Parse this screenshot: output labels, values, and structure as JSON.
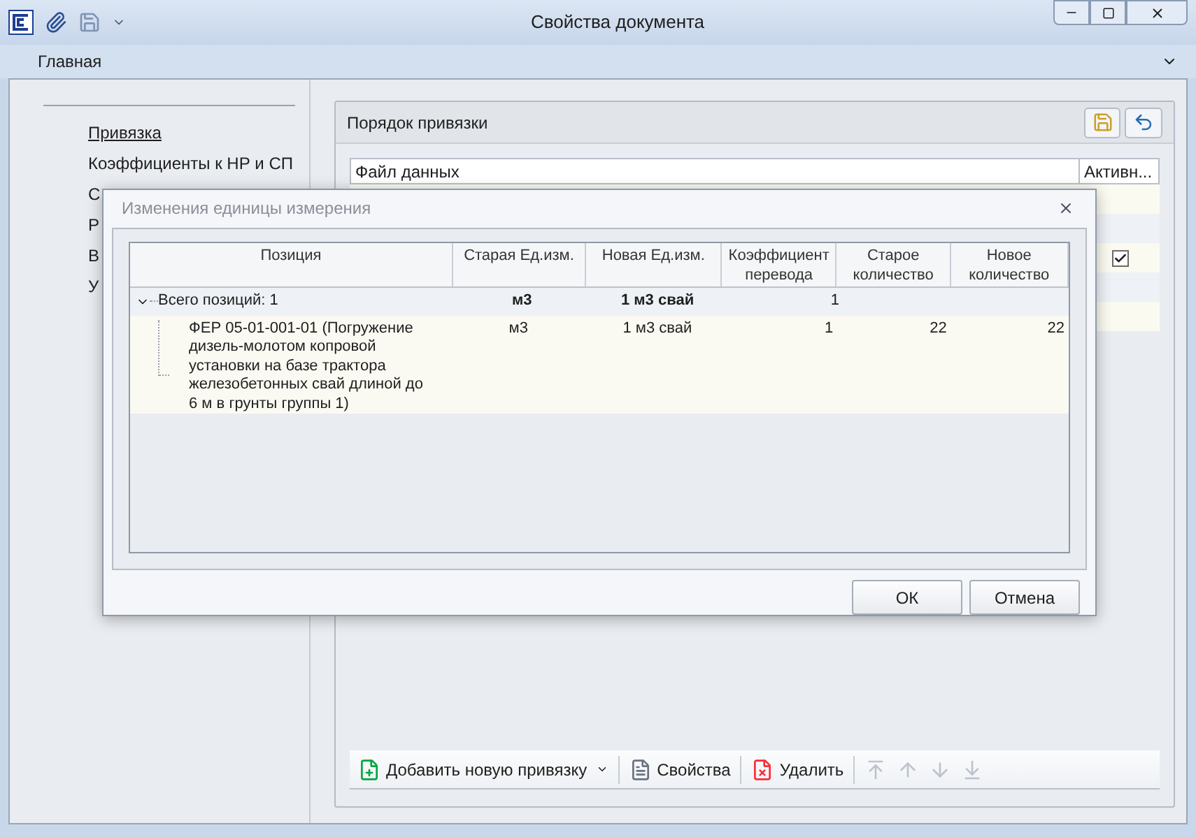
{
  "window": {
    "title": "Свойства документа"
  },
  "ribbon": {
    "tabs": [
      {
        "label": "Главная",
        "selected": true
      }
    ]
  },
  "sidebar": {
    "items": [
      {
        "label": "Привязка",
        "selected": true
      },
      {
        "label": "Коэффициенты к НР и СП",
        "selected": false
      },
      {
        "label": "С",
        "selected": false
      },
      {
        "label": "Р",
        "selected": false
      },
      {
        "label": "В",
        "selected": false
      },
      {
        "label": "У",
        "selected": false
      }
    ]
  },
  "binding_panel": {
    "title": "Порядок привязки",
    "columns": [
      "Файл данных",
      "Активн..."
    ],
    "rows": [
      {
        "active": false
      },
      {
        "active": false
      },
      {
        "active": true
      },
      {
        "active": false
      },
      {
        "active": false
      }
    ],
    "toolbar": [
      {
        "kind": "add",
        "label": "Добавить новую привязку",
        "disabled": false
      },
      {
        "kind": "props",
        "label": "Свойства",
        "disabled": false
      },
      {
        "kind": "delete",
        "label": "Удалить",
        "disabled": false
      },
      {
        "kind": "top",
        "disabled": true
      },
      {
        "kind": "up",
        "disabled": true
      },
      {
        "kind": "down",
        "disabled": true
      },
      {
        "kind": "bottom",
        "disabled": true
      }
    ]
  },
  "dialog": {
    "title": "Изменения единицы измерения",
    "columns": [
      "Позиция",
      "Старая Ед.изм.",
      "Новая Ед.изм.",
      "Коэффициент перевода",
      "Старое количество",
      "Новое количество"
    ],
    "group": {
      "label": "Всего позиций: 1",
      "expanded": true,
      "old_unit": "м3",
      "new_unit": "1 м3 свай",
      "factor": "1"
    },
    "rows": [
      {
        "position": "ФЕР 05-01-001-01 (Погружение дизель-молотом копровой установки на базе трактора железобетонных свай длиной до 6 м в грунты группы 1)",
        "old_unit": "м3",
        "new_unit": "1 м3 свай",
        "factor": "1",
        "old_qty": "22",
        "new_qty": "22"
      }
    ],
    "buttons": [
      "ОК",
      "Отмена"
    ]
  }
}
